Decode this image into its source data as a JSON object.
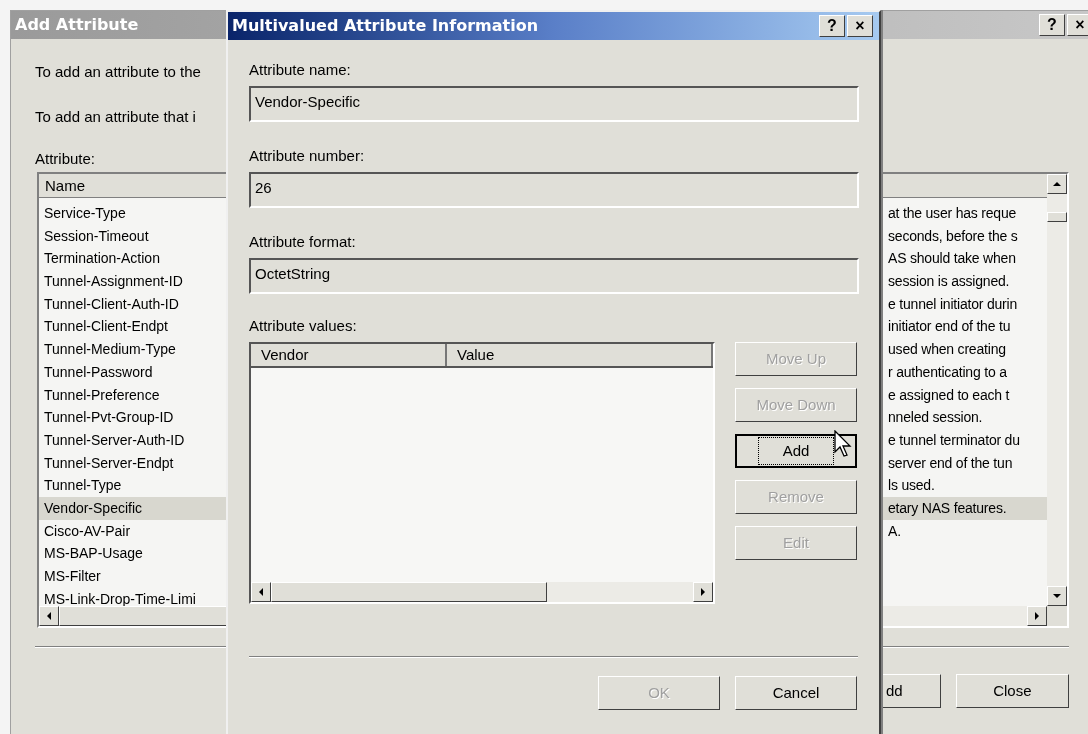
{
  "back_dialog": {
    "title": "Add Attribute",
    "active": false,
    "title_buttons": [
      "?",
      "×"
    ],
    "instructions": [
      "To add an attribute to the",
      "To add an attribute that i"
    ],
    "list_label": {
      "text": "Attribute:"
    },
    "list": {
      "columns": [
        "Name"
      ],
      "rows": [
        {
          "name": "Service-Type",
          "description": "at the user has reque",
          "selected": false
        },
        {
          "name": "Session-Timeout",
          "description": "seconds, before the s",
          "selected": false
        },
        {
          "name": "Termination-Action",
          "description": "AS should take when",
          "selected": false
        },
        {
          "name": "Tunnel-Assignment-ID",
          "description": "session is assigned.",
          "selected": false
        },
        {
          "name": "Tunnel-Client-Auth-ID",
          "description": "e tunnel initiator durin",
          "selected": false
        },
        {
          "name": "Tunnel-Client-Endpt",
          "description": "initiator end of the tu",
          "selected": false
        },
        {
          "name": "Tunnel-Medium-Type",
          "description": "used when creating",
          "selected": false
        },
        {
          "name": "Tunnel-Password",
          "description": "r authenticating to a",
          "selected": false
        },
        {
          "name": "Tunnel-Preference",
          "description": "e assigned to each t",
          "selected": false
        },
        {
          "name": "Tunnel-Pvt-Group-ID",
          "description": "nneled session.",
          "selected": false
        },
        {
          "name": "Tunnel-Server-Auth-ID",
          "description": "e tunnel terminator du",
          "selected": false
        },
        {
          "name": "Tunnel-Server-Endpt",
          "description": "server end of the tun",
          "selected": false
        },
        {
          "name": "Tunnel-Type",
          "description": "ls used.",
          "selected": false
        },
        {
          "name": "Vendor-Specific",
          "description": "etary NAS features.",
          "selected": true
        },
        {
          "name": "Cisco-AV-Pair",
          "description": "A.",
          "selected": false
        },
        {
          "name": "MS-BAP-Usage",
          "selected": false
        },
        {
          "name": "MS-Filter",
          "selected": false
        },
        {
          "name": "MS-Link-Drop-Time-Limi",
          "selected": false
        }
      ]
    },
    "buttons": [
      {
        "label": "dd"
      },
      {
        "label": "Close"
      }
    ]
  },
  "front_dialog": {
    "title": "Multivalued Attribute Information",
    "active": true,
    "title_buttons": [
      "?",
      "×"
    ],
    "fields": [
      {
        "label": "Attribute name:",
        "value": "Vendor-Specific"
      },
      {
        "label": "Attribute number:",
        "value": "26"
      },
      {
        "label": "Attribute format:",
        "value": "OctetString"
      }
    ],
    "values_label": {
      "text": "Attribute values:"
    },
    "values_list": {
      "columns": [
        "Vendor",
        "Value"
      ]
    },
    "side_buttons": [
      {
        "label": "Move Up",
        "disabled": true,
        "default": false
      },
      {
        "label": "Move Down",
        "disabled": true,
        "default": false
      },
      {
        "label": "Add",
        "disabled": false,
        "default": true
      },
      {
        "label": "Remove",
        "disabled": true,
        "default": false
      },
      {
        "label": "Edit",
        "disabled": true,
        "default": false
      }
    ],
    "footer_buttons": [
      {
        "label": "OK",
        "disabled": true
      },
      {
        "label": "Cancel",
        "disabled": false
      }
    ]
  }
}
